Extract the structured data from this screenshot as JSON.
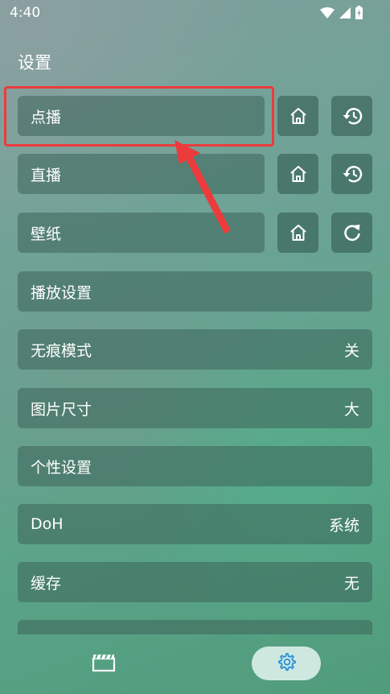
{
  "status_bar": {
    "time": "4:40",
    "icons": [
      "wifi-icon",
      "signal-icon",
      "battery-icon"
    ]
  },
  "page_title": "设置",
  "rows": [
    {
      "label": "点播",
      "buttons": [
        "home-icon",
        "history-icon"
      ]
    },
    {
      "label": "直播",
      "buttons": [
        "home-icon",
        "history-icon"
      ]
    },
    {
      "label": "壁纸",
      "buttons": [
        "home-icon",
        "refresh-icon"
      ]
    },
    {
      "label": "播放设置"
    },
    {
      "label": "无痕模式",
      "value": "关"
    },
    {
      "label": "图片尺寸",
      "value": "大"
    },
    {
      "label": "个性设置"
    },
    {
      "label": "DoH",
      "value": "系统"
    },
    {
      "label": "缓存",
      "value": "无"
    }
  ],
  "bottom_nav": {
    "items": [
      "film-icon",
      "gear-icon"
    ],
    "active": "gear-icon"
  },
  "colors": {
    "highlight": "#ec3b3b",
    "accent": "#2a8fd6"
  }
}
